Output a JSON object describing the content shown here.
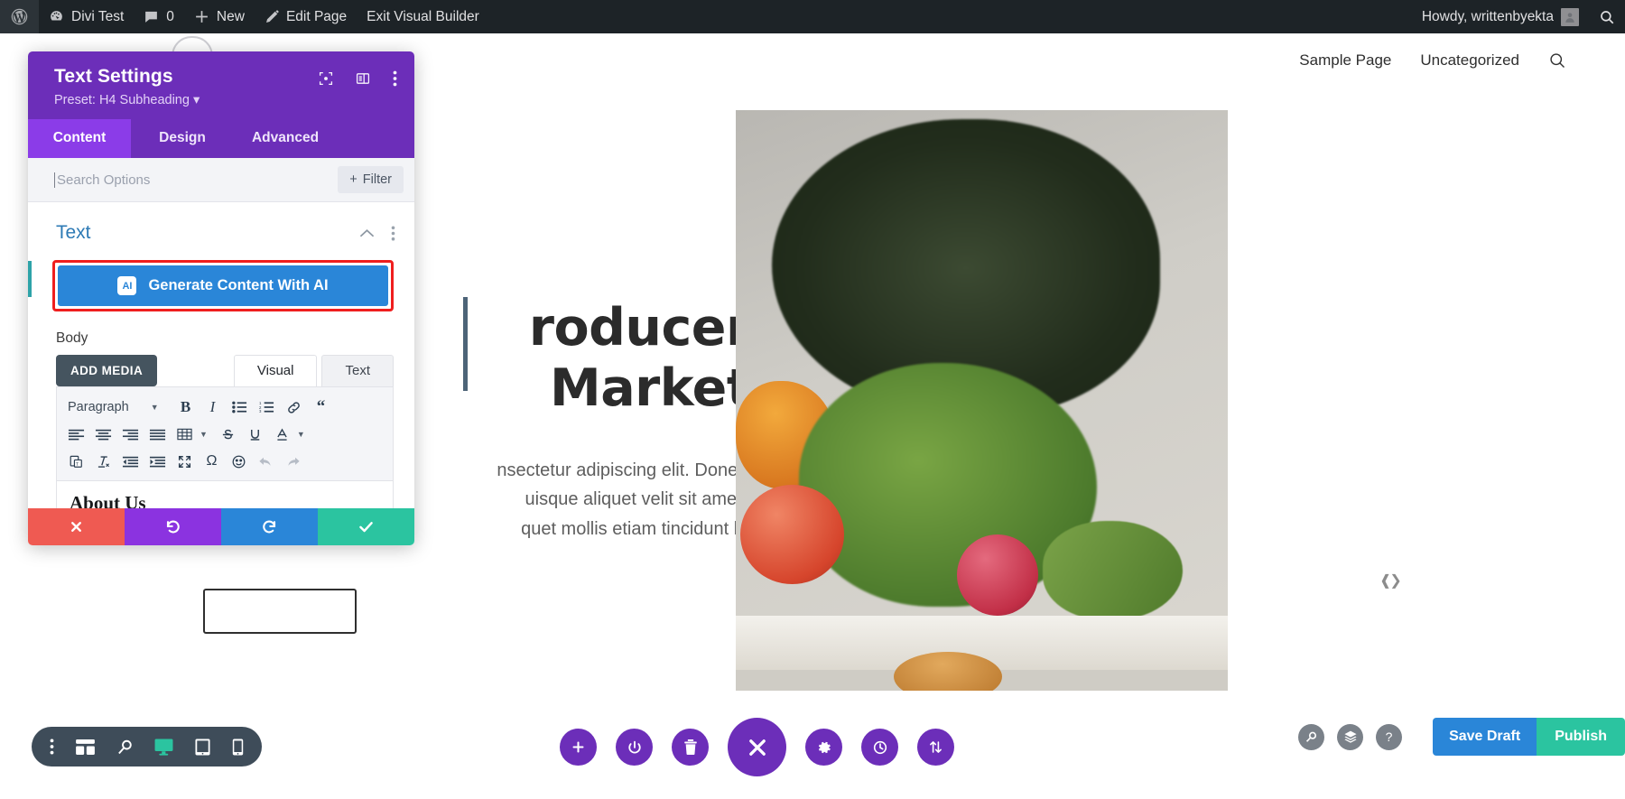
{
  "adminbar": {
    "wp_logo": "wordpress-logo-icon",
    "site_name": "Divi Test",
    "comments_count": "0",
    "new_label": "New",
    "edit_page_label": "Edit Page",
    "exit_builder_label": "Exit Visual Builder",
    "howdy": "Howdy, writtenbyekta",
    "search_icon": "search-icon"
  },
  "sitenav": {
    "links": [
      "Sample Page",
      "Uncategorized"
    ],
    "search_icon": "search-icon"
  },
  "hero": {
    "heading_line1": "roducers",
    "heading_line2": "Markets",
    "paragraph_line1": "nsectetur adipiscing elit. Donec sed",
    "paragraph_line2": "uisque aliquet velit sit amet sem",
    "paragraph_line3": "quet mollis etiam tincidunt ligula."
  },
  "modal": {
    "title": "Text Settings",
    "preset": "Preset: H4 Subheading",
    "preset_caret": "▾",
    "head_icons": [
      "fullscreen-icon",
      "layout-icon",
      "more-options-icon"
    ],
    "tabs": [
      {
        "label": "Content",
        "active": true
      },
      {
        "label": "Design",
        "active": false
      },
      {
        "label": "Advanced",
        "active": false
      }
    ],
    "search_placeholder": "Search Options",
    "search_value": "",
    "filter_label": "Filter",
    "filter_plus": "+",
    "section": {
      "title": "Text",
      "collapse_icon": "chevron-up-icon",
      "more_icon": "more-options-icon"
    },
    "ai_button": {
      "label": "Generate Content With AI",
      "icon_text": "AI",
      "highlight_color": "#ef1e1e",
      "bg_color": "#2a86d8"
    },
    "body_label": "Body",
    "add_media_label": "ADD MEDIA",
    "editor_tabs": [
      {
        "label": "Visual",
        "active": true
      },
      {
        "label": "Text",
        "active": false
      }
    ],
    "toolbar_row1": [
      "Paragraph",
      "bold-icon",
      "italic-icon",
      "bulleted-list-icon",
      "numbered-list-icon",
      "link-icon",
      "blockquote-icon"
    ],
    "toolbar_row2": [
      "align-left-icon",
      "align-center-icon",
      "align-right-icon",
      "align-justify-icon",
      "table-icon",
      "strikethrough-icon",
      "underline-icon",
      "text-color-icon"
    ],
    "toolbar_row3": [
      "paste-as-text-icon",
      "clear-formatting-icon",
      "outdent-icon",
      "indent-icon",
      "fullscreen-icon",
      "special-character-icon",
      "emoji-icon",
      "undo-icon",
      "redo-icon"
    ],
    "paragraph_select": "Paragraph",
    "content_text": "About Us",
    "footer": [
      {
        "name": "cancel",
        "icon": "✕",
        "color": "#ef5a52"
      },
      {
        "name": "undo",
        "icon": "↺",
        "color": "#8b33e0"
      },
      {
        "name": "redo",
        "icon": "↻",
        "color": "#2a86d8"
      },
      {
        "name": "save",
        "icon": "✓",
        "color": "#2bc4a0"
      }
    ]
  },
  "bottombar": {
    "left_icons": [
      "more-options-icon",
      "wireframe-icon",
      "zoom-icon",
      "desktop-icon",
      "tablet-icon",
      "phone-icon"
    ],
    "left_active": "desktop-icon",
    "center_icons": [
      "add-icon",
      "power-icon",
      "trash-icon",
      "close-icon",
      "settings-icon",
      "history-icon",
      "sort-icon"
    ],
    "right_icons": [
      "zoom-icon",
      "layers-icon",
      "help-icon"
    ],
    "save_draft_label": "Save Draft",
    "publish_label": "Publish"
  }
}
